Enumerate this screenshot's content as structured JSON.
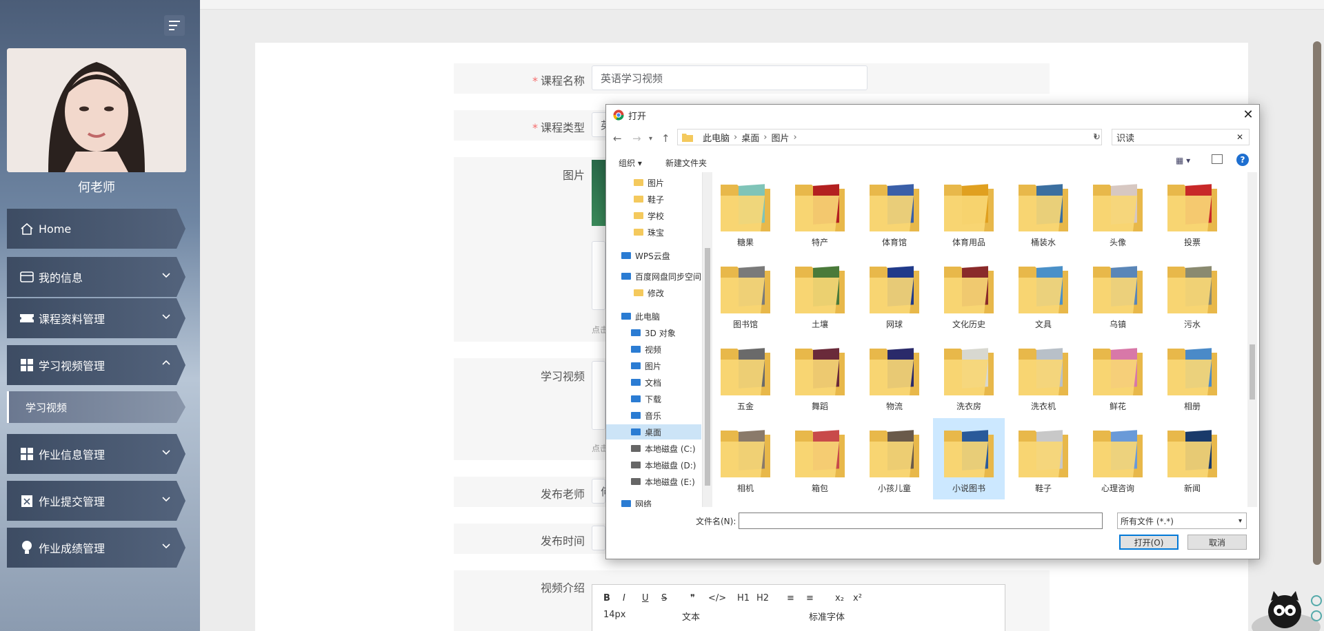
{
  "sidebar": {
    "user_name": "何老师",
    "menu": [
      {
        "label": "Home",
        "icon": "home-icon"
      },
      {
        "label": "我的信息",
        "icon": "card-icon"
      },
      {
        "label": "课程资料管理",
        "icon": "ticket-icon"
      },
      {
        "label": "学习视频管理",
        "icon": "grid-icon"
      },
      {
        "label": "学习视频",
        "icon": ""
      },
      {
        "label": "作业信息管理",
        "icon": "grid-icon"
      },
      {
        "label": "作业提交管理",
        "icon": "clipboard-icon"
      },
      {
        "label": "作业成绩管理",
        "icon": "bulb-icon"
      }
    ]
  },
  "form": {
    "course_name_label": "课程名称",
    "course_name_value": "英语学习视频",
    "course_type_label": "课程类型",
    "course_type_value": "英",
    "image_label": "图片",
    "image_hint": "点击",
    "video_label": "学习视频",
    "video_hint": "点击",
    "teacher_label": "发布老师",
    "teacher_value": "何",
    "time_label": "发布时间",
    "intro_label": "视频介绍",
    "required_mark": "*"
  },
  "editor": {
    "font_size": "14px",
    "text_style": "文本",
    "font_family": "标准字体",
    "buttons": [
      "B",
      "I",
      "U",
      "S",
      "❞",
      "</>",
      "H1",
      "H2",
      "≡",
      "≡",
      "x₂",
      "x²"
    ]
  },
  "dialog": {
    "title": "打开",
    "breadcrumb": [
      "此电脑",
      "桌面",
      "图片"
    ],
    "search_value": "识读",
    "organize_label": "组织",
    "new_folder_label": "新建文件夹",
    "tree": [
      {
        "label": "图片",
        "icon": "folder-icon"
      },
      {
        "label": "鞋子",
        "icon": "folder-icon"
      },
      {
        "label": "学校",
        "icon": "folder-icon"
      },
      {
        "label": "珠宝",
        "icon": "folder-icon"
      },
      {
        "label": "WPS云盘",
        "icon": "cloud-icon"
      },
      {
        "label": "百度网盘同步空间",
        "icon": "baidu-icon"
      },
      {
        "label": "修改",
        "icon": "folder-icon"
      },
      {
        "label": "此电脑",
        "icon": "pc-icon"
      },
      {
        "label": "3D 对象",
        "icon": "cube-icon"
      },
      {
        "label": "视频",
        "icon": "video-icon"
      },
      {
        "label": "图片",
        "icon": "picture-icon"
      },
      {
        "label": "文档",
        "icon": "document-icon"
      },
      {
        "label": "下载",
        "icon": "download-icon"
      },
      {
        "label": "音乐",
        "icon": "music-icon"
      },
      {
        "label": "桌面",
        "icon": "desktop-icon"
      },
      {
        "label": "本地磁盘 (C:)",
        "icon": "disk-icon"
      },
      {
        "label": "本地磁盘 (D:)",
        "icon": "disk-icon"
      },
      {
        "label": "本地磁盘 (E:)",
        "icon": "disk-icon"
      },
      {
        "label": "网络",
        "icon": "network-icon"
      }
    ],
    "folders": [
      {
        "label": "糖果",
        "color": "#7fc4b8"
      },
      {
        "label": "特产",
        "color": "#b32020"
      },
      {
        "label": "体育馆",
        "color": "#3a5fa8"
      },
      {
        "label": "体育用品",
        "color": "#e0a020"
      },
      {
        "label": "桶装水",
        "color": "#3b6fa0"
      },
      {
        "label": "头像",
        "color": "#d7c8c2"
      },
      {
        "label": "投票",
        "color": "#c82828"
      },
      {
        "label": "图书馆",
        "color": "#7a7a7a"
      },
      {
        "label": "土壤",
        "color": "#4a7a3a"
      },
      {
        "label": "网球",
        "color": "#203a8a"
      },
      {
        "label": "文化历史",
        "color": "#8a2a2a"
      },
      {
        "label": "文具",
        "color": "#4a90c8"
      },
      {
        "label": "乌镇",
        "color": "#5a86b8"
      },
      {
        "label": "污水",
        "color": "#8a8a70"
      },
      {
        "label": "五金",
        "color": "#6a6a6a"
      },
      {
        "label": "舞蹈",
        "color": "#6a2a3a"
      },
      {
        "label": "物流",
        "color": "#2a2a6a"
      },
      {
        "label": "洗衣房",
        "color": "#d8d8d0"
      },
      {
        "label": "洗衣机",
        "color": "#b8c0c8"
      },
      {
        "label": "鲜花",
        "color": "#d878a8"
      },
      {
        "label": "相册",
        "color": "#4a8ac8"
      },
      {
        "label": "相机",
        "color": "#8a7a6a"
      },
      {
        "label": "箱包",
        "color": "#c84a4a"
      },
      {
        "label": "小孩儿童",
        "color": "#6a5a4a"
      },
      {
        "label": "小说图书",
        "color": "#2a5a9a"
      },
      {
        "label": "鞋子",
        "color": "#c8c8c8"
      },
      {
        "label": "心理咨询",
        "color": "#6a9ad8"
      },
      {
        "label": "新闻",
        "color": "#1a3a6a"
      }
    ],
    "selected_folder": "小说图书",
    "filename_label": "文件名(N):",
    "filename_value": "",
    "filetype_value": "所有文件 (*.*)",
    "open_button": "打开(O)",
    "cancel_button": "取消"
  }
}
